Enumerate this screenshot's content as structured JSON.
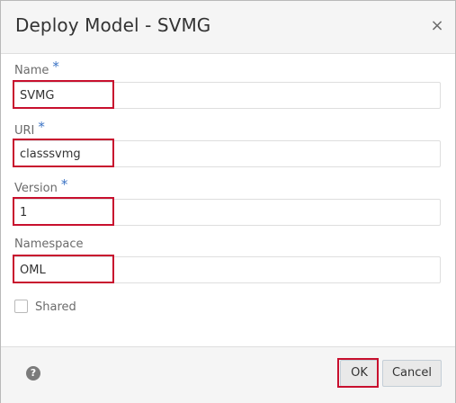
{
  "dialog": {
    "title": "Deploy Model - SVMG",
    "close_icon": "close-icon",
    "close_glyph": "×"
  },
  "form": {
    "name": {
      "label": "Name",
      "required": "*",
      "value": "SVMG"
    },
    "uri": {
      "label": "URI",
      "required": "*",
      "value": "classsvmg"
    },
    "version": {
      "label": "Version",
      "required": "*",
      "value": "1"
    },
    "namespace": {
      "label": "Namespace",
      "value": "OML"
    },
    "shared": {
      "label": "Shared",
      "checked": false
    }
  },
  "footer": {
    "help_icon": "help-icon",
    "help_glyph": "?",
    "ok_label": "OK",
    "cancel_label": "Cancel"
  },
  "colors": {
    "highlight": "#c8102e",
    "required_marker": "#3b73c5"
  }
}
